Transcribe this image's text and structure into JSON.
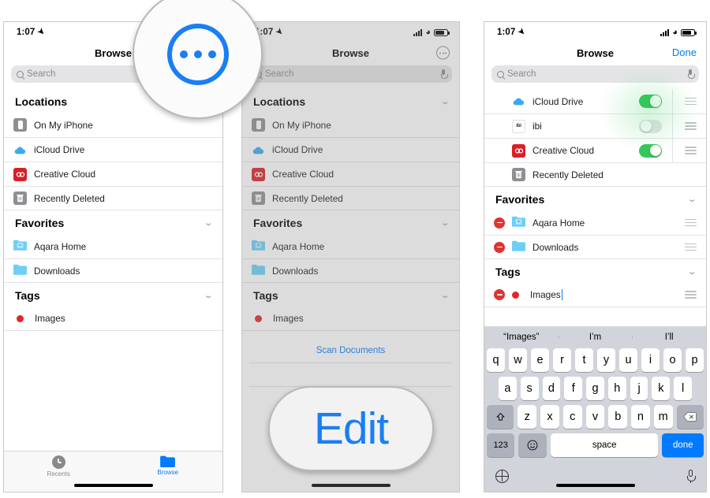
{
  "status": {
    "time": "1:07",
    "location_icon": "location-arrow-icon",
    "battery": "battery-icon",
    "wifi": "wifi-icon",
    "cellular": "cellular-signal-icon"
  },
  "panel1": {
    "nav_title": "Browse",
    "more_button": "more-ellipsis-icon",
    "search_placeholder": "Search",
    "sections": [
      {
        "title": "Locations",
        "rows": [
          {
            "label": "On My iPhone",
            "icon": "iphone-icon"
          },
          {
            "label": "iCloud Drive",
            "icon": "icloud-icon"
          },
          {
            "label": "Creative Cloud",
            "icon": "creative-cloud-icon"
          },
          {
            "label": "Recently Deleted",
            "icon": "trash-icon"
          }
        ]
      },
      {
        "title": "Favorites",
        "rows": [
          {
            "label": "Aqara Home",
            "icon": "folder-home-icon"
          },
          {
            "label": "Downloads",
            "icon": "folder-downloads-icon"
          }
        ]
      },
      {
        "title": "Tags",
        "rows": [
          {
            "label": "Images",
            "icon": "red-tag-dot-icon"
          }
        ]
      }
    ],
    "tabs": [
      {
        "label": "Recents",
        "icon": "clock-icon",
        "active": false
      },
      {
        "label": "Browse",
        "icon": "folder-icon",
        "active": true
      }
    ]
  },
  "magnifier_more": {
    "icon": "more-ellipsis-icon",
    "color": "#1a7ef4"
  },
  "panel2": {
    "nav_title": "Browse",
    "more_button": "more-ellipsis-icon",
    "search_placeholder": "Search",
    "sections": [
      {
        "title": "Locations",
        "rows": [
          {
            "label": "On My iPhone",
            "icon": "iphone-icon"
          },
          {
            "label": "iCloud Drive",
            "icon": "icloud-icon"
          },
          {
            "label": "Creative Cloud",
            "icon": "creative-cloud-icon"
          },
          {
            "label": "Recently Deleted",
            "icon": "trash-icon"
          }
        ]
      },
      {
        "title": "Favorites",
        "rows": [
          {
            "label": "Aqara Home",
            "icon": "folder-home-icon"
          },
          {
            "label": "Downloads",
            "icon": "folder-downloads-icon"
          }
        ]
      },
      {
        "title": "Tags",
        "rows": [
          {
            "label": "Images",
            "icon": "red-tag-dot-icon"
          }
        ]
      }
    ],
    "scan_documents": "Scan Documents"
  },
  "magnifier_edit": {
    "label": "Edit",
    "color": "#1a7ef4"
  },
  "panel3": {
    "nav_title": "Browse",
    "done_label": "Done",
    "search_placeholder": "Search",
    "location_rows": [
      {
        "label": "iCloud Drive",
        "icon": "icloud-icon",
        "toggle": "on"
      },
      {
        "label": "ibi",
        "icon": "ibi-icon",
        "toggle": "off"
      },
      {
        "label": "Creative Cloud",
        "icon": "creative-cloud-icon",
        "toggle": "on"
      },
      {
        "label": "Recently Deleted",
        "icon": "trash-icon",
        "toggle": "none"
      }
    ],
    "favorites_title": "Favorites",
    "favorite_rows": [
      {
        "label": "Aqara Home",
        "icon": "folder-home-icon"
      },
      {
        "label": "Downloads",
        "icon": "folder-downloads-icon"
      }
    ],
    "tags_title": "Tags",
    "tag_rows": [
      {
        "label": "Images",
        "icon": "red-tag-dot-icon"
      }
    ],
    "keyboard": {
      "predictions": [
        "“Images”",
        "I’m",
        "I’ll"
      ],
      "row1": [
        "q",
        "w",
        "e",
        "r",
        "t",
        "y",
        "u",
        "i",
        "o",
        "p"
      ],
      "row2": [
        "a",
        "s",
        "d",
        "f",
        "g",
        "h",
        "j",
        "k",
        "l"
      ],
      "row3": [
        "z",
        "x",
        "c",
        "v",
        "b",
        "n",
        "m"
      ],
      "shift_key": "shift-icon",
      "backspace_key": "backspace-icon",
      "numbers_key": "123",
      "emoji_key": "emoji-icon",
      "space_key": "space",
      "return_key": "done",
      "globe_key": "globe-icon",
      "dictation_key": "microphone-icon"
    }
  },
  "colors": {
    "accent": "#007aff",
    "toggle_on": "#34c759",
    "delete_red": "#e0332e",
    "tag_red": "#e4232a",
    "magnifier_blue": "#1a7ef4"
  }
}
